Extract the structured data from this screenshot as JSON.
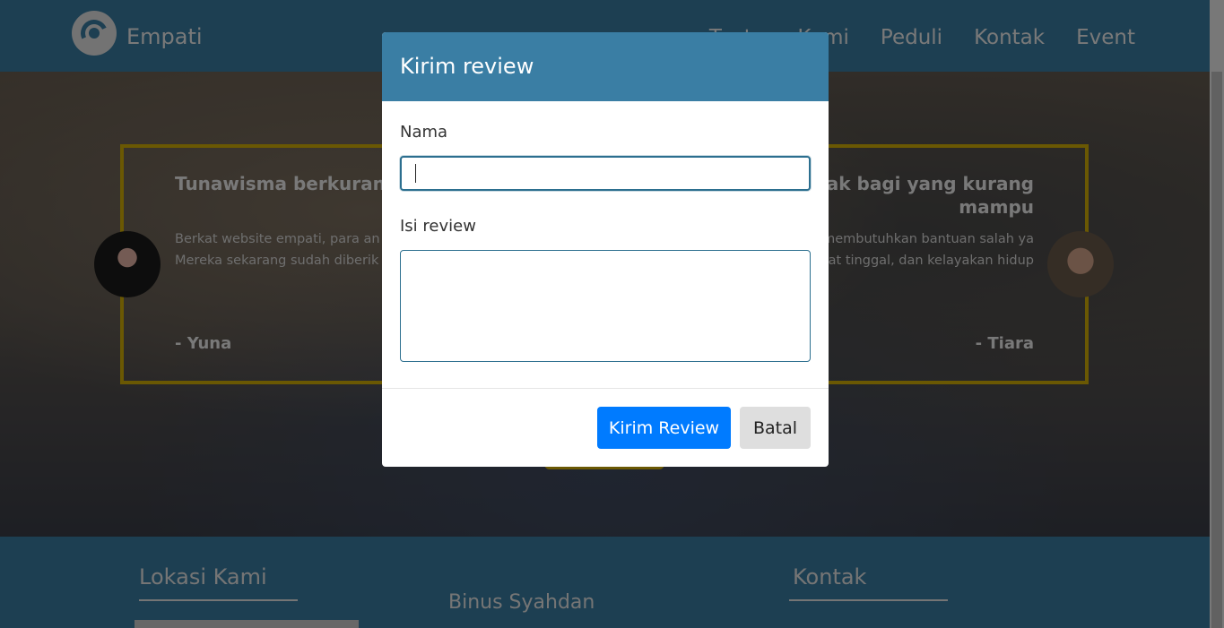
{
  "nav": {
    "brand": "Empati",
    "links": [
      "Tentang Kami",
      "Peduli",
      "Kontak",
      "Event"
    ]
  },
  "testimonials": [
    {
      "title": "Tunawisma berkurang saya",
      "body": "Berkat website empati, para an atau tunawisma berkurang di te Mereka sekarang sudah diberik tinggal di rusun.",
      "author": "- Yuna"
    },
    {
      "title": "ikan tempat layak bagi yang kurang mampu",
      "body": "empati sangat membantu bagi g membutuhkan bantuan salah ya masalah tempat tinggal, dan kelayakan hidup",
      "author": "- Tiara"
    }
  ],
  "footer": {
    "lokasi_heading": "Lokasi Kami",
    "lokasi_sub": "Binus Syahdan",
    "kontak_heading": "Kontak"
  },
  "modal": {
    "title": "Kirim review",
    "nama_label": "Nama",
    "nama_value": "",
    "isi_label": "Isi review",
    "isi_value": "",
    "submit_label": "Kirim Review",
    "cancel_label": "Batal"
  },
  "colors": {
    "primary_teal": "#3a7ea4",
    "accent_gold": "#d4b106",
    "button_blue": "#007bff"
  }
}
